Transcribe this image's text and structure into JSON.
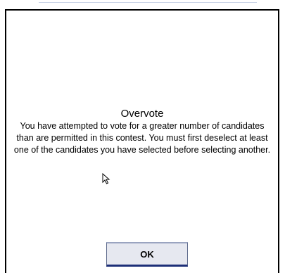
{
  "dialog": {
    "title": "Overvote",
    "message": "You have attempted to vote for a greater number of candidates than are permitted in this contest. You must first deselect at least one of the candidates you have selected before selecting another.",
    "ok_label": "OK"
  },
  "icons": {
    "cursor": "mouse-pointer-icon"
  },
  "colors": {
    "button_accent": "#1d2f78",
    "button_face": "#e6e8f0"
  }
}
